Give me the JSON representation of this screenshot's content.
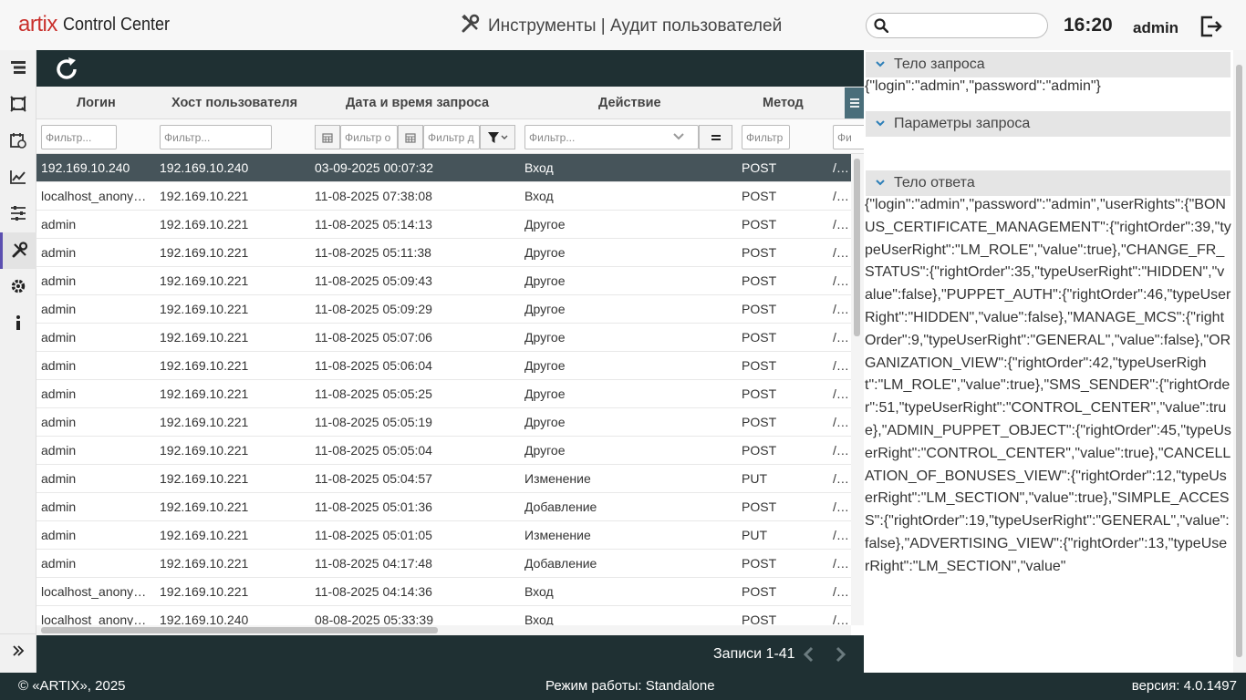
{
  "header": {
    "logo_brand": "artix",
    "logo_text": "Control Center",
    "title": "Инструменты | Аудит пользователей",
    "search_placeholder": "",
    "clock": "16:20",
    "user": "admin"
  },
  "toolbar": {
    "refresh_icon": "refresh-icon"
  },
  "table": {
    "columns": [
      "Логин",
      "Хост пользователя",
      "Дата и время запроса",
      "Действие",
      "Метод"
    ],
    "filters": {
      "login": "Фильтр...",
      "host": "Фильтр...",
      "date_from": "Фильтр о",
      "date_to": "Фильтр д",
      "action": "Фильтр...",
      "method": "Фильтр",
      "path": "Фи"
    },
    "rows": [
      {
        "login": "192.169.10.240",
        "host": "192.169.10.240",
        "date": "03-09-2025 00:07:32",
        "action": "Вход",
        "method": "POST",
        "path": "/CS"
      },
      {
        "login": "localhost_anonymous",
        "host": "192.169.10.221",
        "date": "11-08-2025 07:38:08",
        "action": "Вход",
        "method": "POST",
        "path": "/CS"
      },
      {
        "login": "admin",
        "host": "192.169.10.221",
        "date": "11-08-2025 05:14:13",
        "action": "Другое",
        "method": "POST",
        "path": "/CS"
      },
      {
        "login": "admin",
        "host": "192.169.10.221",
        "date": "11-08-2025 05:11:38",
        "action": "Другое",
        "method": "POST",
        "path": "/CS"
      },
      {
        "login": "admin",
        "host": "192.169.10.221",
        "date": "11-08-2025 05:09:43",
        "action": "Другое",
        "method": "POST",
        "path": "/CS"
      },
      {
        "login": "admin",
        "host": "192.169.10.221",
        "date": "11-08-2025 05:09:29",
        "action": "Другое",
        "method": "POST",
        "path": "/CS"
      },
      {
        "login": "admin",
        "host": "192.169.10.221",
        "date": "11-08-2025 05:07:06",
        "action": "Другое",
        "method": "POST",
        "path": "/CS"
      },
      {
        "login": "admin",
        "host": "192.169.10.221",
        "date": "11-08-2025 05:06:04",
        "action": "Другое",
        "method": "POST",
        "path": "/CS"
      },
      {
        "login": "admin",
        "host": "192.169.10.221",
        "date": "11-08-2025 05:05:25",
        "action": "Другое",
        "method": "POST",
        "path": "/CS"
      },
      {
        "login": "admin",
        "host": "192.169.10.221",
        "date": "11-08-2025 05:05:19",
        "action": "Другое",
        "method": "POST",
        "path": "/CS"
      },
      {
        "login": "admin",
        "host": "192.169.10.221",
        "date": "11-08-2025 05:05:04",
        "action": "Другое",
        "method": "POST",
        "path": "/CS"
      },
      {
        "login": "admin",
        "host": "192.169.10.221",
        "date": "11-08-2025 05:04:57",
        "action": "Изменение",
        "method": "PUT",
        "path": "/CS"
      },
      {
        "login": "admin",
        "host": "192.169.10.221",
        "date": "11-08-2025 05:01:36",
        "action": "Добавление",
        "method": "POST",
        "path": "/CS"
      },
      {
        "login": "admin",
        "host": "192.169.10.221",
        "date": "11-08-2025 05:01:05",
        "action": "Изменение",
        "method": "PUT",
        "path": "/CS"
      },
      {
        "login": "admin",
        "host": "192.169.10.221",
        "date": "11-08-2025 04:17:48",
        "action": "Добавление",
        "method": "POST",
        "path": "/CS"
      },
      {
        "login": "localhost_anonymous",
        "host": "192.169.10.221",
        "date": "11-08-2025 04:14:36",
        "action": "Вход",
        "method": "POST",
        "path": "/CS"
      },
      {
        "login": "localhost_anonymous",
        "host": "192.169.10.240",
        "date": "08-08-2025 05:33:39",
        "action": "Вход",
        "method": "POST",
        "path": "/CS"
      }
    ]
  },
  "pager": {
    "text": "Записи 1-41"
  },
  "details": {
    "request_body_title": "Тело запроса",
    "request_body": "{\"login\":\"admin\",\"password\":\"admin\"}",
    "request_params_title": "Параметры запроса",
    "request_params": "",
    "response_body_title": "Тело ответа",
    "response_body": "{\"login\":\"admin\",\"password\":\"admin\",\"userRights\":{\"BONUS_CERTIFICATE_MANAGEMENT\":{\"rightOrder\":39,\"typeUserRight\":\"LM_ROLE\",\"value\":true},\"CHANGE_FR_STATUS\":{\"rightOrder\":35,\"typeUserRight\":\"HIDDEN\",\"value\":false},\"PUPPET_AUTH\":{\"rightOrder\":46,\"typeUserRight\":\"HIDDEN\",\"value\":false},\"MANAGE_MCS\":{\"rightOrder\":9,\"typeUserRight\":\"GENERAL\",\"value\":false},\"ORGANIZATION_VIEW\":{\"rightOrder\":42,\"typeUserRight\":\"LM_ROLE\",\"value\":true},\"SMS_SENDER\":{\"rightOrder\":51,\"typeUserRight\":\"CONTROL_CENTER\",\"value\":true},\"ADMIN_PUPPET_OBJECT\":{\"rightOrder\":45,\"typeUserRight\":\"CONTROL_CENTER\",\"value\":true},\"CANCELLATION_OF_BONUSES_VIEW\":{\"rightOrder\":12,\"typeUserRight\":\"LM_SECTION\",\"value\":true},\"SIMPLE_ACCESS\":{\"rightOrder\":19,\"typeUserRight\":\"GENERAL\",\"value\":false},\"ADVERTISING_VIEW\":{\"rightOrder\":13,\"typeUserRight\":\"LM_SECTION\",\"value\""
  },
  "footer": {
    "copyright": "© «ARTIX», 2025",
    "mode": "Режим работы: Standalone",
    "version": "версия: 4.0.1497"
  },
  "colors": {
    "dark": "#1f3033",
    "accent": "#c9302c",
    "selected_row": "#46545a",
    "active_marker": "#5b4fb0"
  },
  "sidebar_icons": [
    "tree-icon",
    "frame-icon",
    "calendar-clock-icon",
    "chart-icon",
    "sliders-icon",
    "tools-icon",
    "gear-icon",
    "info-icon"
  ]
}
